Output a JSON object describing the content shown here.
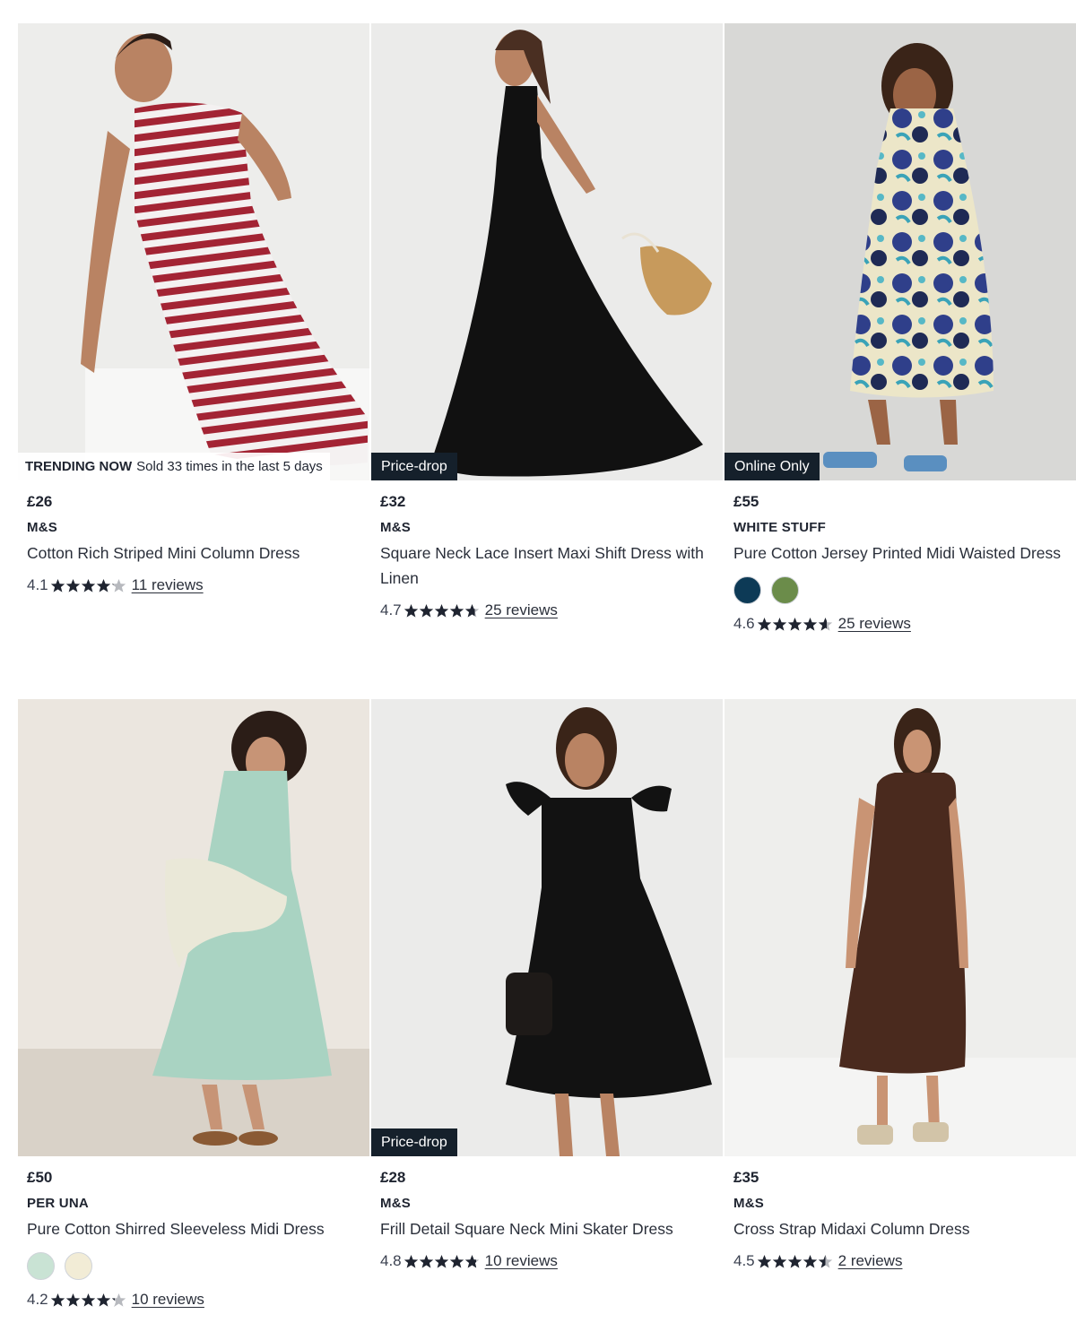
{
  "products": [
    {
      "badge": {
        "type": "trending",
        "strong": "TRENDING NOW",
        "text": "Sold 33 times in the last 5 days"
      },
      "price": "£26",
      "brand": "M&S",
      "title": "Cotton Rich Striped Mini Column Dress",
      "swatches": [],
      "rating": {
        "value": "4.1",
        "stars": 4.1,
        "reviews": "11 reviews"
      },
      "image": {
        "bg": "#ededeb",
        "dress": "#a32434",
        "kind": "stripe"
      }
    },
    {
      "badge": {
        "type": "dark",
        "text": "Price-drop"
      },
      "price": "£32",
      "brand": "M&S",
      "title": "Square Neck Lace Insert Maxi Shift Dress with Linen",
      "swatches": [],
      "rating": {
        "value": "4.7",
        "stars": 4.7,
        "reviews": "25 reviews"
      },
      "image": {
        "bg": "#ebebea",
        "dress": "#111111",
        "kind": "maxi"
      }
    },
    {
      "badge": {
        "type": "dark",
        "text": "Online Only"
      },
      "price": "£55",
      "brand": "WHITE STUFF",
      "title": "Pure Cotton Jersey Printed Midi Waisted Dress",
      "swatches": [
        "#0d3a56",
        "#6b8c4a"
      ],
      "rating": {
        "value": "4.6",
        "stars": 4.6,
        "reviews": "25 reviews"
      },
      "image": {
        "bg": "#d8d8d6",
        "dress": "#2f3f8a",
        "kind": "print"
      }
    },
    {
      "badge": null,
      "price": "£50",
      "brand": "PER UNA",
      "title": "Pure Cotton Shirred Sleeveless Midi Dress",
      "swatches": [
        "#c9e3d4",
        "#f2ecd6"
      ],
      "rating": {
        "value": "4.2",
        "stars": 4.2,
        "reviews": "10 reviews"
      },
      "image": {
        "bg": "#ebe6df",
        "dress": "#a9d3c2",
        "kind": "midi"
      }
    },
    {
      "badge": {
        "type": "dark",
        "text": "Price-drop"
      },
      "price": "£28",
      "brand": "M&S",
      "title": "Frill Detail Square Neck Mini Skater Dress",
      "swatches": [],
      "rating": {
        "value": "4.8",
        "stars": 4.8,
        "reviews": "10 reviews"
      },
      "image": {
        "bg": "#ebebea",
        "dress": "#121212",
        "kind": "skater"
      }
    },
    {
      "badge": null,
      "price": "£35",
      "brand": "M&S",
      "title": "Cross Strap Midaxi Column Dress",
      "swatches": [],
      "rating": {
        "value": "4.5",
        "stars": 4.5,
        "reviews": "2 reviews"
      },
      "image": {
        "bg": "#eeeeec",
        "dress": "#4a2a1e",
        "kind": "column"
      }
    }
  ],
  "colors": {
    "text": "#1f2430",
    "badge": "#15202b",
    "star": "#1f2430",
    "star_empty": "#b7b9be"
  }
}
